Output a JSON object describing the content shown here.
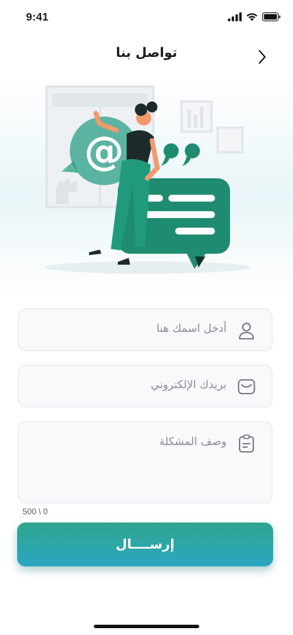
{
  "status_bar": {
    "time": "9:41"
  },
  "header": {
    "title": "تواصل بنا"
  },
  "form": {
    "name_placeholder": "أدخل اسمك هنا",
    "email_placeholder": "بريدك الإلكتروني",
    "description_placeholder": "وصف المشكلة",
    "char_counter": "500 \\ 0"
  },
  "submit": {
    "label": "إرســــال"
  },
  "colors": {
    "accent_start": "#2fa58f",
    "accent_end": "#2ba6c0",
    "illustration_green": "#1f8c72"
  }
}
